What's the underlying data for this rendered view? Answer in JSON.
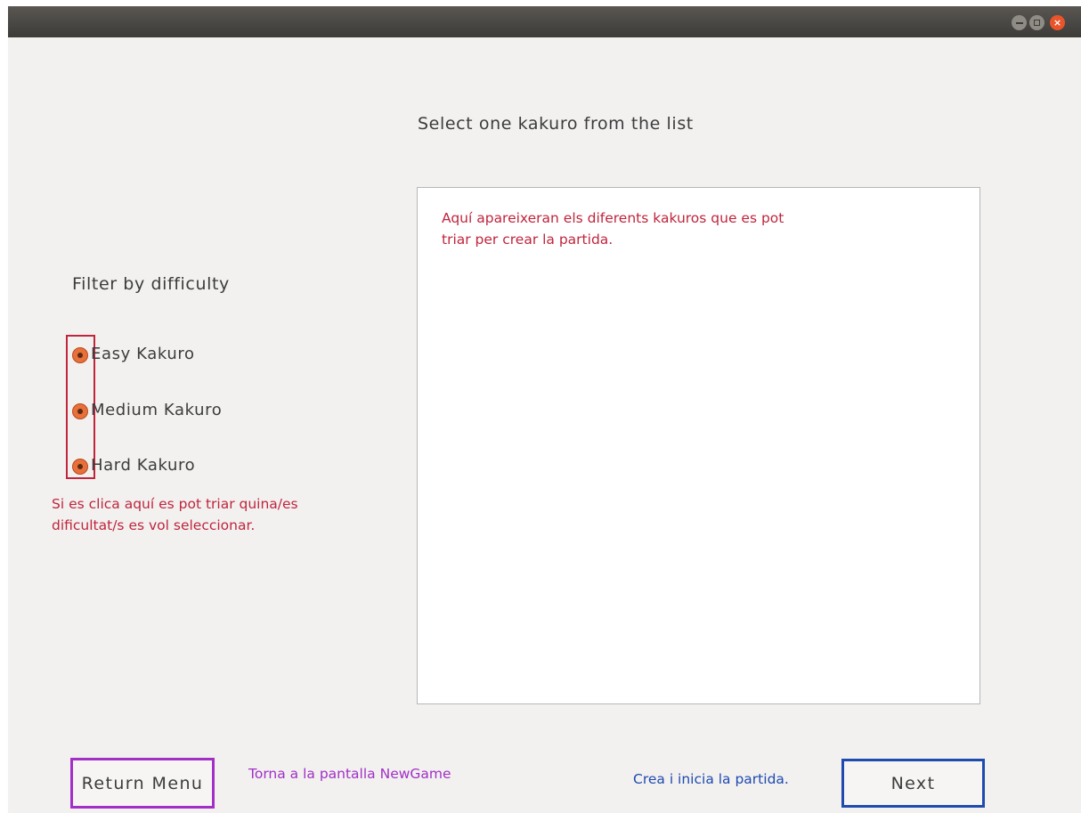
{
  "window": {
    "controls": [
      {
        "name": "minimize",
        "icon": "minimize-icon"
      },
      {
        "name": "maximize",
        "icon": "maximize-icon"
      },
      {
        "name": "close",
        "icon": "close-icon",
        "glyph": "×"
      }
    ]
  },
  "main": {
    "heading": "Select one kakuro from the list",
    "list_note": "Aquí apareixeran els diferents kakuros que es pot triar per crear la partida."
  },
  "filter": {
    "label": "Filter by difficulty",
    "options": [
      {
        "label": "Easy Kakuro"
      },
      {
        "label": "Medium Kakuro"
      },
      {
        "label": "Hard Kakuro"
      }
    ],
    "note": "Si es clica aquí es pot triar quina/es dificultat/s es vol seleccionar."
  },
  "footer": {
    "return_label": "Return Menu",
    "return_note": "Torna a la pantalla NewGame",
    "next_label": "Next",
    "next_note": "Crea i inicia la partida."
  },
  "colors": {
    "annotation_red": "#c0253c",
    "annotation_purple": "#a230c6",
    "annotation_blue": "#1f4ab0",
    "radio_accent": "#e8703a",
    "window_bg": "#f2f1f0",
    "titlebar": "#3c3b37"
  }
}
